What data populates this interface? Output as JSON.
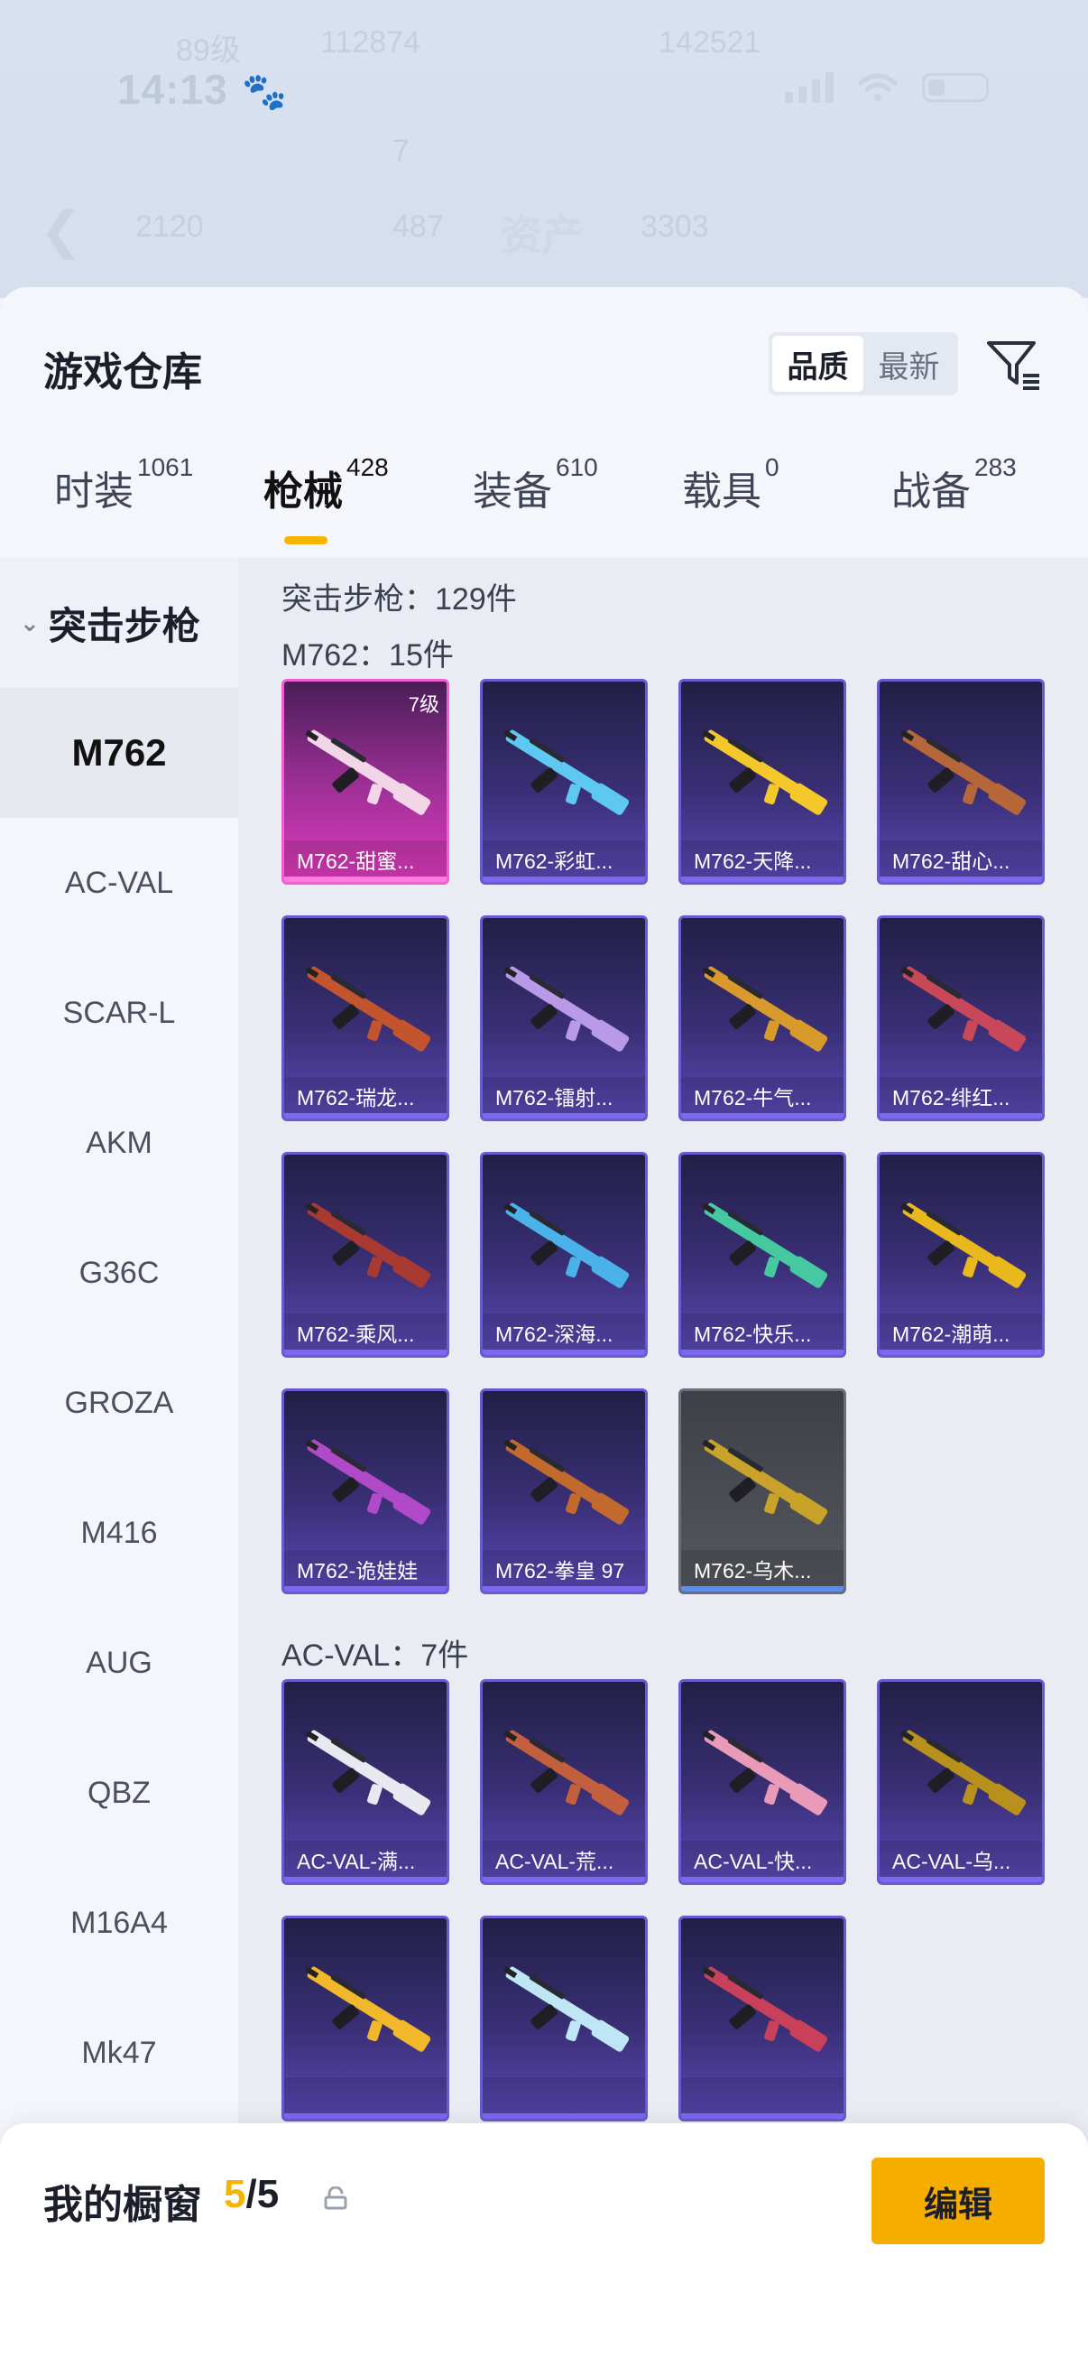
{
  "status_bar": {
    "time": "14:13"
  },
  "background": {
    "title": "资产",
    "faint_texts": [
      "89级",
      "112874",
      "142521",
      "7",
      "2120",
      "487",
      "3303"
    ]
  },
  "sheet": {
    "title": "游戏仓库",
    "sort_options": [
      {
        "label": "品质",
        "active": true
      },
      {
        "label": "最新",
        "active": false
      }
    ],
    "tabs": [
      {
        "label": "时装",
        "count": "1061",
        "active": false
      },
      {
        "label": "枪械",
        "count": "428",
        "active": true
      },
      {
        "label": "装备",
        "count": "610",
        "active": false
      },
      {
        "label": "载具",
        "count": "0",
        "active": false
      },
      {
        "label": "战备",
        "count": "283",
        "active": false
      }
    ]
  },
  "sidebar": {
    "group": "突击步枪",
    "items": [
      "M762",
      "AC-VAL",
      "SCAR-L",
      "AKM",
      "G36C",
      "GROZA",
      "M416",
      "AUG",
      "QBZ",
      "M16A4",
      "Mk47"
    ],
    "active_index": 0
  },
  "content": {
    "category_summary": "突击步枪：129件",
    "sections": [
      {
        "label": "M762：15件",
        "items": [
          {
            "name": "M762-甜蜜...",
            "level": "7级",
            "style": "pink",
            "gun_color": "#f2d6e8"
          },
          {
            "name": "M762-彩虹...",
            "style": "purple",
            "gun_color": "#5ec8f0"
          },
          {
            "name": "M762-天降...",
            "style": "purple",
            "gun_color": "#f4c72a"
          },
          {
            "name": "M762-甜心...",
            "style": "purple",
            "gun_color": "#b5673a"
          },
          {
            "name": "M762-瑞龙...",
            "style": "purple",
            "gun_color": "#c2542e"
          },
          {
            "name": "M762-镭射...",
            "style": "purple",
            "gun_color": "#b89ae8"
          },
          {
            "name": "M762-牛气...",
            "style": "purple",
            "gun_color": "#d89a2a"
          },
          {
            "name": "M762-绯红...",
            "style": "purple",
            "gun_color": "#c8485a"
          },
          {
            "name": "M762-乘风...",
            "style": "purple",
            "gun_color": "#a83a32"
          },
          {
            "name": "M762-深海...",
            "style": "purple",
            "gun_color": "#4ab2e8"
          },
          {
            "name": "M762-快乐...",
            "style": "purple",
            "gun_color": "#46c8a0"
          },
          {
            "name": "M762-潮萌...",
            "style": "purple",
            "gun_color": "#e8b81c"
          },
          {
            "name": "M762-诡娃娃",
            "style": "purple",
            "gun_color": "#b04ac8"
          },
          {
            "name": "M762-拳皇 97",
            "style": "purple",
            "gun_color": "#c26a2e"
          },
          {
            "name": "M762-乌木...",
            "style": "gray",
            "gun_color": "#c9a22a"
          }
        ]
      },
      {
        "label": "AC-VAL：7件",
        "items": [
          {
            "name": "AC-VAL-满...",
            "style": "purple",
            "gun_color": "#e8e8f0"
          },
          {
            "name": "AC-VAL-荒...",
            "style": "purple",
            "gun_color": "#c2603e"
          },
          {
            "name": "AC-VAL-快...",
            "style": "purple",
            "gun_color": "#e89ab8"
          },
          {
            "name": "AC-VAL-乌...",
            "style": "purple",
            "gun_color": "#b8901c"
          },
          {
            "name": "",
            "style": "purple",
            "gun_color": "#f0b82a"
          },
          {
            "name": "",
            "style": "purple",
            "gun_color": "#bfe6f5"
          },
          {
            "name": "",
            "style": "purple",
            "gun_color": "#c8405a"
          }
        ]
      }
    ]
  },
  "showcase": {
    "label": "我的橱窗",
    "count_current": "5",
    "count_total": "/5",
    "edit_label": "编辑"
  },
  "colors": {
    "accent": "#f5b400",
    "card_border": "#6a5ad0"
  }
}
